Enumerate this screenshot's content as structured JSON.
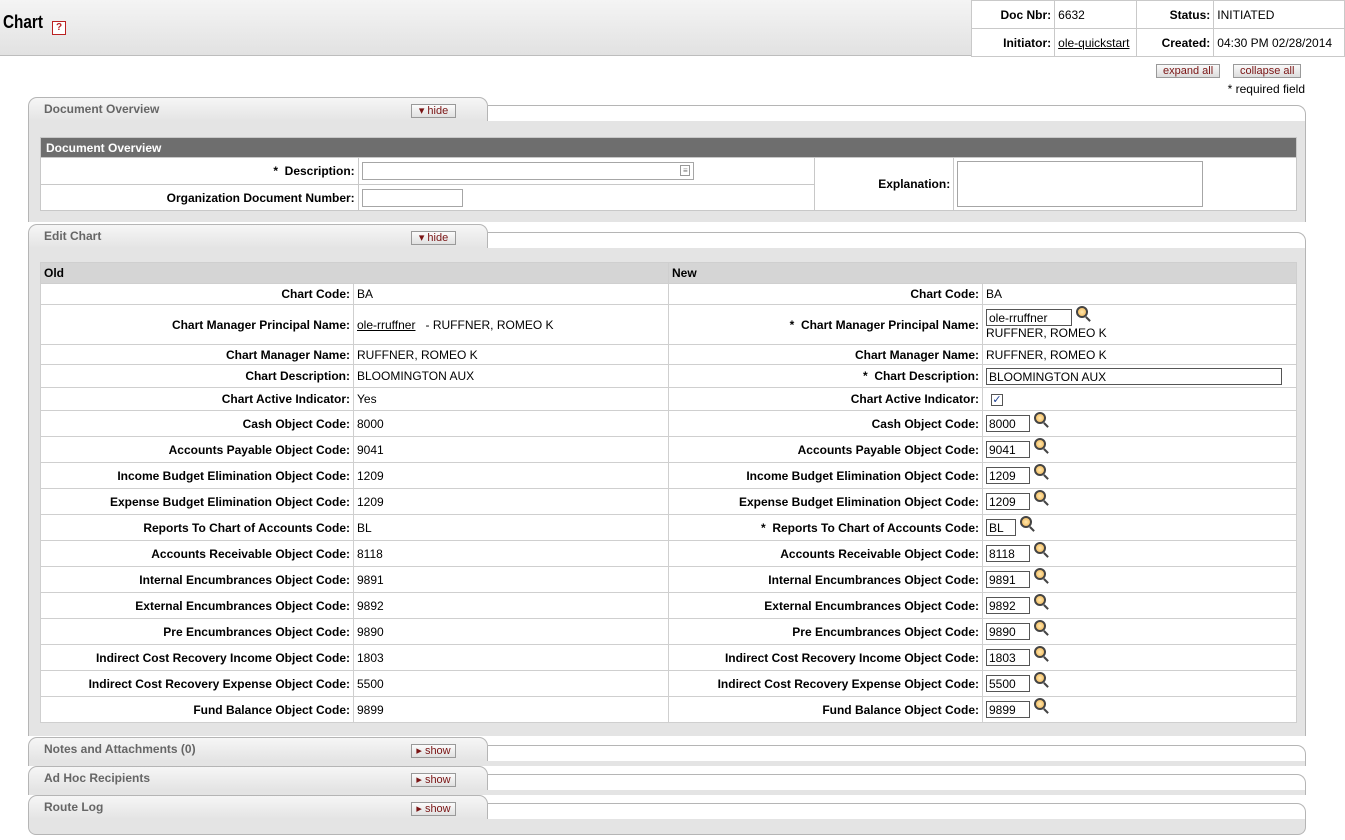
{
  "header": {
    "title": "Chart",
    "help_icon": "?",
    "doc_nbr_label": "Doc Nbr:",
    "doc_nbr": "6632",
    "status_label": "Status:",
    "status": "INITIATED",
    "initiator_label": "Initiator:",
    "initiator": "ole-quickstart",
    "created_label": "Created:",
    "created": "04:30 PM 02/28/2014"
  },
  "actions": {
    "expand_all": "expand all",
    "collapse_all": "collapse all",
    "required_note": "* required field"
  },
  "tabs": {
    "overview": {
      "title": "Document Overview",
      "button": "hide"
    },
    "edit": {
      "title": "Edit Chart",
      "button": "hide"
    },
    "notes": {
      "title": "Notes and Attachments (0)",
      "button": "show"
    },
    "adhoc": {
      "title": "Ad Hoc Recipients",
      "button": "show"
    },
    "route": {
      "title": "Route Log",
      "button": "show"
    }
  },
  "overview": {
    "section_header": "Document Overview",
    "description_label": "Description:",
    "description_value": "",
    "org_doc_label": "Organization Document Number:",
    "org_doc_value": "",
    "explanation_label": "Explanation:",
    "explanation_value": "",
    "required_marker": "*"
  },
  "edit": {
    "old_header": "Old",
    "new_header": "New",
    "required_marker": "*",
    "chart_code_label": "Chart Code:",
    "chart_code_old": "BA",
    "chart_code_new": "BA",
    "manager_principal_label": "Chart Manager Principal Name:",
    "manager_principal_old_link": "ole-rruffner",
    "manager_principal_old_name": "- RUFFNER, ROMEO K",
    "manager_principal_new_value": "ole-rruffner",
    "manager_principal_new_name": "RUFFNER, ROMEO K",
    "manager_name_label": "Chart Manager Name:",
    "manager_name_old": "RUFFNER, ROMEO K",
    "manager_name_new": "RUFFNER, ROMEO K",
    "description_label": "Chart Description:",
    "description_old": "BLOOMINGTON AUX",
    "description_new": "BLOOMINGTON AUX",
    "active_label": "Chart Active Indicator:",
    "active_old": "Yes",
    "active_new_check": "✓",
    "rows": [
      {
        "label": "Cash Object Code:",
        "old": "8000",
        "new": "8000",
        "required": false
      },
      {
        "label": "Accounts Payable Object Code:",
        "old": "9041",
        "new": "9041",
        "required": false
      },
      {
        "label": "Income Budget Elimination Object Code:",
        "old": "1209",
        "new": "1209",
        "required": false
      },
      {
        "label": "Expense Budget Elimination Object Code:",
        "old": "1209",
        "new": "1209",
        "required": false
      },
      {
        "label": "Reports To Chart of Accounts Code:",
        "old": "BL",
        "new": "BL",
        "required": true
      },
      {
        "label": "Accounts Receivable Object Code:",
        "old": "8118",
        "new": "8118",
        "required": false
      },
      {
        "label": "Internal Encumbrances Object Code:",
        "old": "9891",
        "new": "9891",
        "required": false
      },
      {
        "label": "External Encumbrances Object Code:",
        "old": "9892",
        "new": "9892",
        "required": false
      },
      {
        "label": "Pre Encumbrances Object Code:",
        "old": "9890",
        "new": "9890",
        "required": false
      },
      {
        "label": "Indirect Cost Recovery Income Object Code:",
        "old": "1803",
        "new": "1803",
        "required": false
      },
      {
        "label": "Indirect Cost Recovery Expense Object Code:",
        "old": "5500",
        "new": "5500",
        "required": false
      },
      {
        "label": "Fund Balance Object Code:",
        "old": "9899",
        "new": "9899",
        "required": false
      }
    ]
  }
}
